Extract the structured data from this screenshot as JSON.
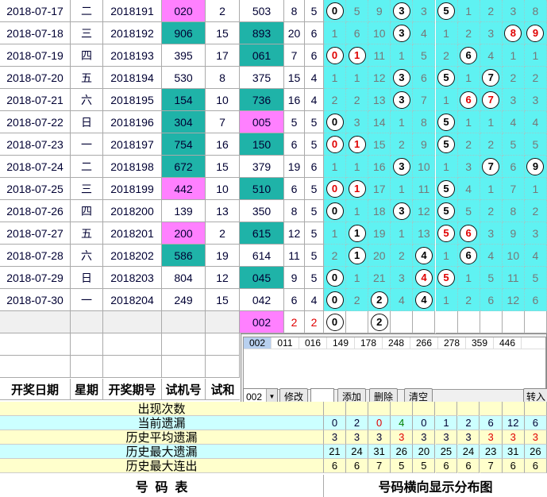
{
  "rows": [
    {
      "date": "2018-07-17",
      "wd": "二",
      "period": "2018191",
      "trial": "020",
      "trial_hl": "pk",
      "he": "2",
      "num": "503",
      "num_hl": "",
      "a": "8",
      "b": "5",
      "cells": [
        [
          "b",
          "0"
        ],
        [
          "n",
          "5"
        ],
        [
          "n",
          "9"
        ],
        [
          "b",
          "3"
        ],
        [
          "n",
          "3"
        ],
        [
          "b",
          "5"
        ],
        [
          "n",
          "1"
        ],
        [
          "n",
          "2"
        ],
        [
          "n",
          "3"
        ],
        [
          "n",
          "8"
        ]
      ]
    },
    {
      "date": "2018-07-18",
      "wd": "三",
      "period": "2018192",
      "trial": "906",
      "trial_hl": "tl",
      "he": "15",
      "num": "893",
      "num_hl": "tl",
      "a": "20",
      "b": "6",
      "cells": [
        [
          "n",
          "1"
        ],
        [
          "n",
          "6"
        ],
        [
          "n",
          "10"
        ],
        [
          "b",
          "3"
        ],
        [
          "n",
          "4"
        ],
        [
          "n",
          "1"
        ],
        [
          "n",
          "2"
        ],
        [
          "n",
          "3"
        ],
        [
          "r",
          "8"
        ],
        [
          "r",
          "9"
        ]
      ]
    },
    {
      "date": "2018-07-19",
      "wd": "四",
      "period": "2018193",
      "trial": "395",
      "trial_hl": "",
      "he": "17",
      "num": "061",
      "num_hl": "tl",
      "a": "7",
      "b": "6",
      "cells": [
        [
          "r",
          "0"
        ],
        [
          "r",
          "1"
        ],
        [
          "n",
          "11"
        ],
        [
          "n",
          "1"
        ],
        [
          "n",
          "5"
        ],
        [
          "n",
          "2"
        ],
        [
          "b",
          "6"
        ],
        [
          "n",
          "4"
        ],
        [
          "n",
          "1"
        ],
        [
          "n",
          "1"
        ]
      ]
    },
    {
      "date": "2018-07-20",
      "wd": "五",
      "period": "2018194",
      "trial": "530",
      "trial_hl": "",
      "he": "8",
      "num": "375",
      "num_hl": "",
      "a": "15",
      "b": "4",
      "cells": [
        [
          "n",
          "1"
        ],
        [
          "n",
          "1"
        ],
        [
          "n",
          "12"
        ],
        [
          "b",
          "3"
        ],
        [
          "n",
          "6"
        ],
        [
          "b",
          "5"
        ],
        [
          "n",
          "1"
        ],
        [
          "b",
          "7"
        ],
        [
          "n",
          "2"
        ],
        [
          "n",
          "2"
        ]
      ]
    },
    {
      "date": "2018-07-21",
      "wd": "六",
      "period": "2018195",
      "trial": "154",
      "trial_hl": "tl",
      "he": "10",
      "num": "736",
      "num_hl": "tl",
      "a": "16",
      "b": "4",
      "cells": [
        [
          "n",
          "2"
        ],
        [
          "n",
          "2"
        ],
        [
          "n",
          "13"
        ],
        [
          "b",
          "3"
        ],
        [
          "n",
          "7"
        ],
        [
          "n",
          "1"
        ],
        [
          "r",
          "6"
        ],
        [
          "r",
          "7"
        ],
        [
          "n",
          "3"
        ],
        [
          "n",
          "3"
        ]
      ]
    },
    {
      "date": "2018-07-22",
      "wd": "日",
      "period": "2018196",
      "trial": "304",
      "trial_hl": "tl",
      "he": "7",
      "num": "005",
      "num_hl": "pk",
      "a": "5",
      "b": "5",
      "cells": [
        [
          "b",
          "0"
        ],
        [
          "n",
          "3"
        ],
        [
          "n",
          "14"
        ],
        [
          "n",
          "1"
        ],
        [
          "n",
          "8"
        ],
        [
          "b",
          "5"
        ],
        [
          "n",
          "1"
        ],
        [
          "n",
          "1"
        ],
        [
          "n",
          "4"
        ],
        [
          "n",
          "4"
        ]
      ]
    },
    {
      "date": "2018-07-23",
      "wd": "一",
      "period": "2018197",
      "trial": "754",
      "trial_hl": "tl",
      "he": "16",
      "num": "150",
      "num_hl": "tl",
      "a": "6",
      "b": "5",
      "cells": [
        [
          "r",
          "0"
        ],
        [
          "r",
          "1"
        ],
        [
          "n",
          "15"
        ],
        [
          "n",
          "2"
        ],
        [
          "n",
          "9"
        ],
        [
          "b",
          "5"
        ],
        [
          "n",
          "2"
        ],
        [
          "n",
          "2"
        ],
        [
          "n",
          "5"
        ],
        [
          "n",
          "5"
        ]
      ]
    },
    {
      "date": "2018-07-24",
      "wd": "二",
      "period": "2018198",
      "trial": "672",
      "trial_hl": "tl",
      "he": "15",
      "num": "379",
      "num_hl": "",
      "a": "19",
      "b": "6",
      "cells": [
        [
          "n",
          "1"
        ],
        [
          "n",
          "1"
        ],
        [
          "n",
          "16"
        ],
        [
          "b",
          "3"
        ],
        [
          "n",
          "10"
        ],
        [
          "n",
          "1"
        ],
        [
          "n",
          "3"
        ],
        [
          "b",
          "7"
        ],
        [
          "n",
          "6"
        ],
        [
          "b",
          "9"
        ]
      ]
    },
    {
      "date": "2018-07-25",
      "wd": "三",
      "period": "2018199",
      "trial": "442",
      "trial_hl": "pk",
      "he": "10",
      "num": "510",
      "num_hl": "tl",
      "a": "6",
      "b": "5",
      "cells": [
        [
          "r",
          "0"
        ],
        [
          "r",
          "1"
        ],
        [
          "n",
          "17"
        ],
        [
          "n",
          "1"
        ],
        [
          "n",
          "11"
        ],
        [
          "b",
          "5"
        ],
        [
          "n",
          "4"
        ],
        [
          "n",
          "1"
        ],
        [
          "n",
          "7"
        ],
        [
          "n",
          "1"
        ]
      ]
    },
    {
      "date": "2018-07-26",
      "wd": "四",
      "period": "2018200",
      "trial": "139",
      "trial_hl": "",
      "he": "13",
      "num": "350",
      "num_hl": "",
      "a": "8",
      "b": "5",
      "cells": [
        [
          "b",
          "0"
        ],
        [
          "n",
          "1"
        ],
        [
          "n",
          "18"
        ],
        [
          "b",
          "3"
        ],
        [
          "n",
          "12"
        ],
        [
          "b",
          "5"
        ],
        [
          "n",
          "5"
        ],
        [
          "n",
          "2"
        ],
        [
          "n",
          "8"
        ],
        [
          "n",
          "2"
        ]
      ]
    },
    {
      "date": "2018-07-27",
      "wd": "五",
      "period": "2018201",
      "trial": "200",
      "trial_hl": "pk",
      "he": "2",
      "num": "615",
      "num_hl": "tl",
      "a": "12",
      "b": "5",
      "cells": [
        [
          "n",
          "1"
        ],
        [
          "b",
          "1"
        ],
        [
          "n",
          "19"
        ],
        [
          "n",
          "1"
        ],
        [
          "n",
          "13"
        ],
        [
          "r",
          "5"
        ],
        [
          "r",
          "6"
        ],
        [
          "n",
          "3"
        ],
        [
          "n",
          "9"
        ],
        [
          "n",
          "3"
        ]
      ]
    },
    {
      "date": "2018-07-28",
      "wd": "六",
      "period": "2018202",
      "trial": "586",
      "trial_hl": "tl",
      "he": "19",
      "num": "614",
      "num_hl": "",
      "a": "11",
      "b": "5",
      "cells": [
        [
          "n",
          "2"
        ],
        [
          "b",
          "1"
        ],
        [
          "n",
          "20"
        ],
        [
          "n",
          "2"
        ],
        [
          "b",
          "4"
        ],
        [
          "n",
          "1"
        ],
        [
          "b",
          "6"
        ],
        [
          "n",
          "4"
        ],
        [
          "n",
          "10"
        ],
        [
          "n",
          "4"
        ]
      ]
    },
    {
      "date": "2018-07-29",
      "wd": "日",
      "period": "2018203",
      "trial": "804",
      "trial_hl": "",
      "he": "12",
      "num": "045",
      "num_hl": "tl",
      "a": "9",
      "b": "5",
      "cells": [
        [
          "b",
          "0"
        ],
        [
          "n",
          "1"
        ],
        [
          "n",
          "21"
        ],
        [
          "n",
          "3"
        ],
        [
          "r",
          "4"
        ],
        [
          "r",
          "5"
        ],
        [
          "n",
          "1"
        ],
        [
          "n",
          "5"
        ],
        [
          "n",
          "11"
        ],
        [
          "n",
          "5"
        ]
      ]
    },
    {
      "date": "2018-07-30",
      "wd": "一",
      "period": "2018204",
      "trial": "249",
      "trial_hl": "",
      "he": "15",
      "num": "042",
      "num_hl": "",
      "a": "6",
      "b": "4",
      "cells": [
        [
          "b",
          "0"
        ],
        [
          "n",
          "2"
        ],
        [
          "b",
          "2"
        ],
        [
          "n",
          "4"
        ],
        [
          "b",
          "4"
        ],
        [
          "n",
          "1"
        ],
        [
          "n",
          "2"
        ],
        [
          "n",
          "6"
        ],
        [
          "n",
          "12"
        ],
        [
          "n",
          "6"
        ]
      ]
    }
  ],
  "extra": {
    "num": "002",
    "a": "2",
    "b": "2",
    "balls": [
      "0",
      "2"
    ]
  },
  "panel": {
    "items": [
      "002",
      "011",
      "016",
      "149",
      "178",
      "248",
      "266",
      "278",
      "359",
      "446"
    ],
    "select_value": "002",
    "buttons": {
      "modify": "修改",
      "add": "添加",
      "delete": "删除",
      "clear": "清空",
      "import": "转入"
    }
  },
  "header": {
    "date": "开奖日期",
    "weekday": "星期",
    "period": "开奖期号",
    "trial": "试机号",
    "he": "试和"
  },
  "stats": [
    {
      "label": "出现次数",
      "values": [],
      "bg": "#ffffcc"
    },
    {
      "label": "当前遗漏",
      "values": [
        "0",
        "2",
        "0",
        "4",
        "0",
        "1",
        "2",
        "6",
        "12",
        "6"
      ],
      "colors": [
        "#003",
        "#003",
        "#e00000",
        "#008000",
        "#003",
        "#003",
        "#003",
        "#003",
        "#003",
        "#003"
      ],
      "bg": "#ccffff"
    },
    {
      "label": "历史平均遗漏",
      "values": [
        "3",
        "3",
        "3",
        "3",
        "3",
        "3",
        "3",
        "3",
        "3",
        "3"
      ],
      "colors": [
        "#003",
        "#003",
        "#003",
        "#e00000",
        "#003",
        "#003",
        "#003",
        "#e00000",
        "#e00000",
        "#e00000"
      ],
      "bg": "#ffffcc"
    },
    {
      "label": "历史最大遗漏",
      "values": [
        "21",
        "24",
        "31",
        "26",
        "20",
        "25",
        "24",
        "23",
        "31",
        "26"
      ],
      "bg": "#ccffff"
    },
    {
      "label": "历史最大连出",
      "values": [
        "6",
        "6",
        "7",
        "5",
        "5",
        "6",
        "6",
        "7",
        "6",
        "6"
      ],
      "bg": "#ffffcc"
    }
  ],
  "footer": {
    "left": "号  码  表",
    "right": "号码横向显示分布图"
  },
  "colors": {
    "cyan": "#00e5e5",
    "pink": "#ff80ff",
    "teal": "#1fb3a8",
    "aqua": "#5ff2f2"
  }
}
